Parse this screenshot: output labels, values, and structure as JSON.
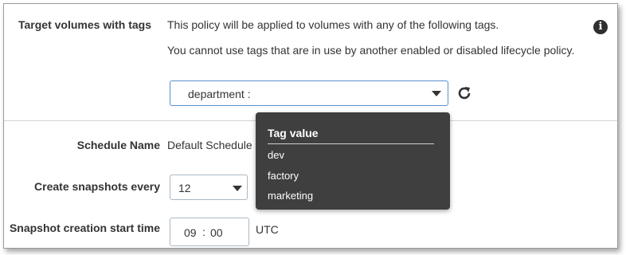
{
  "target_tags": {
    "label": "Target volumes with tags",
    "info_line1": "This policy will be applied to volumes with any of the following tags.",
    "info_line2": "You cannot use tags that are in use by another enabled or disabled lifecycle policy.",
    "select_value": "department :",
    "info_icon": "info-icon",
    "refresh_icon": "refresh-icon"
  },
  "schedule": {
    "name_label": "Schedule Name",
    "name_value": "Default Schedule",
    "every_label": "Create snapshots every",
    "every_value": "12",
    "start_label": "Snapshot creation start time",
    "start_hour": "09",
    "start_sep": ":",
    "start_min": "00",
    "timezone": "UTC"
  },
  "tag_dropdown": {
    "header": "Tag value",
    "options": [
      "dev",
      "factory",
      "marketing"
    ]
  },
  "colors": {
    "dropdown_bg": "#3f3f3f",
    "focus_border": "#5b8fd0"
  }
}
